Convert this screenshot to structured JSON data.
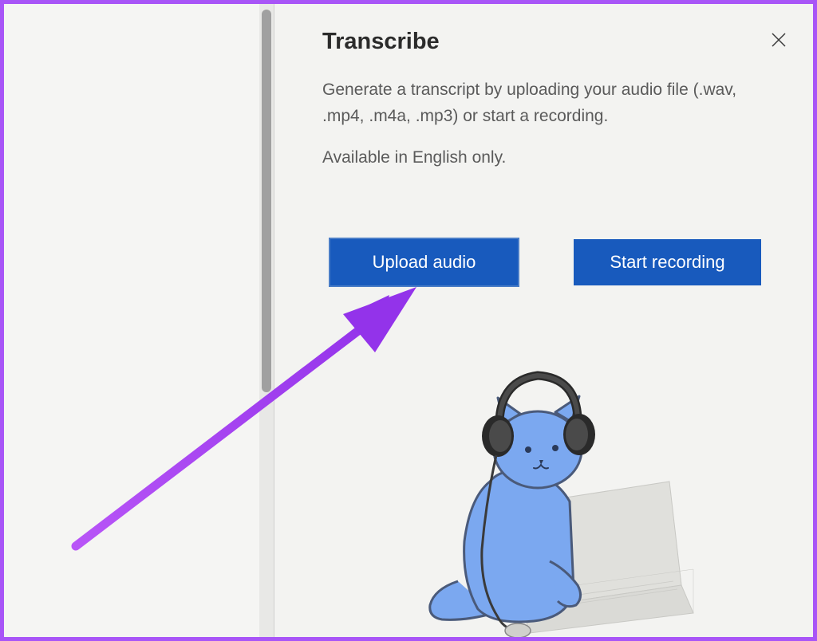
{
  "panel": {
    "title": "Transcribe",
    "description": "Generate a transcript by uploading your audio file (.wav, .mp4, .m4a, .mp3) or start a recording.",
    "subtext": "Available in English only.",
    "upload_label": "Upload audio",
    "record_label": "Start recording"
  }
}
